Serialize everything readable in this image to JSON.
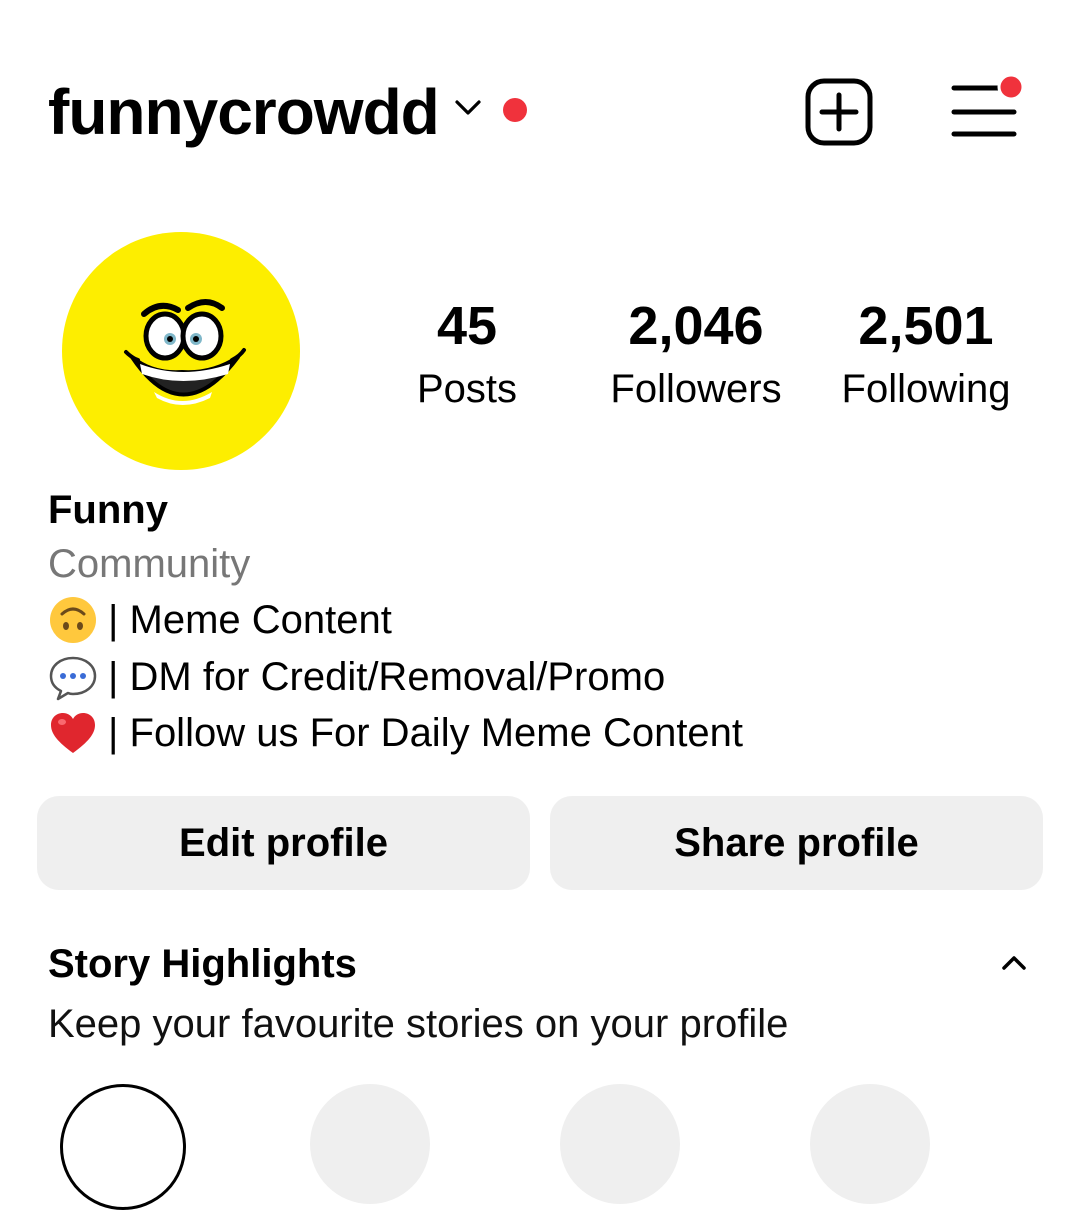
{
  "header": {
    "username": "funnycrowdd",
    "chevron_icon": "chevron-down-icon",
    "new_post_icon": "plus-square-icon",
    "menu_icon": "hamburger-menu-icon",
    "accent": "#f0323c"
  },
  "profile": {
    "avatar_color": "#fdee00",
    "avatar_icon": "grinning-face-icon",
    "stats": [
      {
        "value": "45",
        "label": "Posts"
      },
      {
        "value": "2,046",
        "label": "Followers"
      },
      {
        "value": "2,501",
        "label": "Following"
      }
    ],
    "name": "Funny",
    "category": "Community",
    "bio": [
      {
        "icon": "upside-down-face-icon",
        "text": "| Meme Content"
      },
      {
        "icon": "speech-balloon-icon",
        "text": "| DM for Credit/Removal/Promo"
      },
      {
        "icon": "red-heart-icon",
        "text": "| Follow us For Daily Meme Content"
      }
    ]
  },
  "actions": {
    "edit_label": "Edit profile",
    "share_label": "Share profile"
  },
  "highlights": {
    "title": "Story Highlights",
    "subtitle": "Keep your favourite stories on your profile",
    "toggle_icon": "chevron-up-icon"
  }
}
